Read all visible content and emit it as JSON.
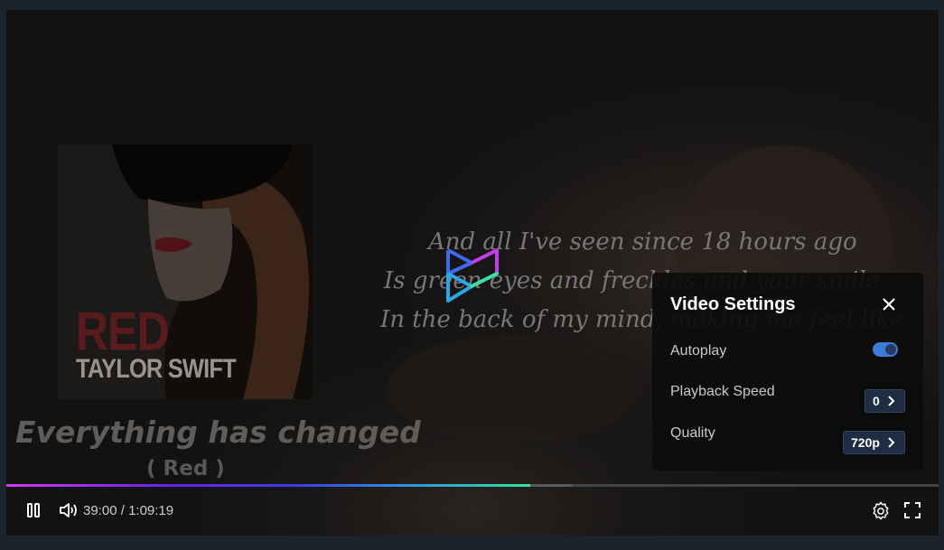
{
  "album": {
    "title": "RED",
    "artist": "TAYLOR SWIFT"
  },
  "song": {
    "title": "Everything has changed",
    "subtitle": "( Red )"
  },
  "lyrics": [
    "And all I've seen since 18 hours ago",
    "Is green eyes and freckles and your smile",
    "In the back of my mind, making me feel like"
  ],
  "settings": {
    "title": "Video Settings",
    "autoplay_label": "Autoplay",
    "autoplay_on": true,
    "speed_label": "Playback Speed",
    "speed_value": "0",
    "quality_label": "Quality",
    "quality_value": "720p"
  },
  "player": {
    "current_time": "39:00",
    "separator": "/",
    "duration": "1:09:19",
    "played_fraction": 0.562,
    "buffered_fraction": 0.607
  },
  "colors": {
    "accent": "#3d7bd8",
    "progress_start": "#d23cf0",
    "progress_end": "#35e39a"
  },
  "icons": [
    "pause-icon",
    "volume-icon",
    "gear-icon",
    "fullscreen-icon",
    "close-icon",
    "chevron-right-icon"
  ]
}
